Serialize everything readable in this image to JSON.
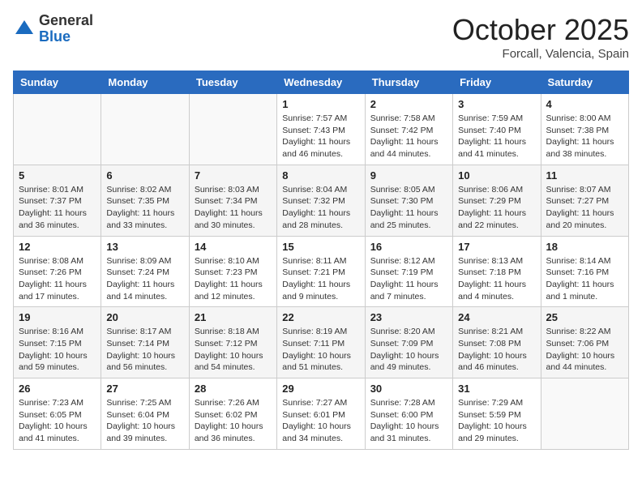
{
  "header": {
    "logo_general": "General",
    "logo_blue": "Blue",
    "month_title": "October 2025",
    "location": "Forcall, Valencia, Spain"
  },
  "weekdays": [
    "Sunday",
    "Monday",
    "Tuesday",
    "Wednesday",
    "Thursday",
    "Friday",
    "Saturday"
  ],
  "weeks": [
    [
      {
        "day": "",
        "info": ""
      },
      {
        "day": "",
        "info": ""
      },
      {
        "day": "",
        "info": ""
      },
      {
        "day": "1",
        "info": "Sunrise: 7:57 AM\nSunset: 7:43 PM\nDaylight: 11 hours and 46 minutes."
      },
      {
        "day": "2",
        "info": "Sunrise: 7:58 AM\nSunset: 7:42 PM\nDaylight: 11 hours and 44 minutes."
      },
      {
        "day": "3",
        "info": "Sunrise: 7:59 AM\nSunset: 7:40 PM\nDaylight: 11 hours and 41 minutes."
      },
      {
        "day": "4",
        "info": "Sunrise: 8:00 AM\nSunset: 7:38 PM\nDaylight: 11 hours and 38 minutes."
      }
    ],
    [
      {
        "day": "5",
        "info": "Sunrise: 8:01 AM\nSunset: 7:37 PM\nDaylight: 11 hours and 36 minutes."
      },
      {
        "day": "6",
        "info": "Sunrise: 8:02 AM\nSunset: 7:35 PM\nDaylight: 11 hours and 33 minutes."
      },
      {
        "day": "7",
        "info": "Sunrise: 8:03 AM\nSunset: 7:34 PM\nDaylight: 11 hours and 30 minutes."
      },
      {
        "day": "8",
        "info": "Sunrise: 8:04 AM\nSunset: 7:32 PM\nDaylight: 11 hours and 28 minutes."
      },
      {
        "day": "9",
        "info": "Sunrise: 8:05 AM\nSunset: 7:30 PM\nDaylight: 11 hours and 25 minutes."
      },
      {
        "day": "10",
        "info": "Sunrise: 8:06 AM\nSunset: 7:29 PM\nDaylight: 11 hours and 22 minutes."
      },
      {
        "day": "11",
        "info": "Sunrise: 8:07 AM\nSunset: 7:27 PM\nDaylight: 11 hours and 20 minutes."
      }
    ],
    [
      {
        "day": "12",
        "info": "Sunrise: 8:08 AM\nSunset: 7:26 PM\nDaylight: 11 hours and 17 minutes."
      },
      {
        "day": "13",
        "info": "Sunrise: 8:09 AM\nSunset: 7:24 PM\nDaylight: 11 hours and 14 minutes."
      },
      {
        "day": "14",
        "info": "Sunrise: 8:10 AM\nSunset: 7:23 PM\nDaylight: 11 hours and 12 minutes."
      },
      {
        "day": "15",
        "info": "Sunrise: 8:11 AM\nSunset: 7:21 PM\nDaylight: 11 hours and 9 minutes."
      },
      {
        "day": "16",
        "info": "Sunrise: 8:12 AM\nSunset: 7:19 PM\nDaylight: 11 hours and 7 minutes."
      },
      {
        "day": "17",
        "info": "Sunrise: 8:13 AM\nSunset: 7:18 PM\nDaylight: 11 hours and 4 minutes."
      },
      {
        "day": "18",
        "info": "Sunrise: 8:14 AM\nSunset: 7:16 PM\nDaylight: 11 hours and 1 minute."
      }
    ],
    [
      {
        "day": "19",
        "info": "Sunrise: 8:16 AM\nSunset: 7:15 PM\nDaylight: 10 hours and 59 minutes."
      },
      {
        "day": "20",
        "info": "Sunrise: 8:17 AM\nSunset: 7:14 PM\nDaylight: 10 hours and 56 minutes."
      },
      {
        "day": "21",
        "info": "Sunrise: 8:18 AM\nSunset: 7:12 PM\nDaylight: 10 hours and 54 minutes."
      },
      {
        "day": "22",
        "info": "Sunrise: 8:19 AM\nSunset: 7:11 PM\nDaylight: 10 hours and 51 minutes."
      },
      {
        "day": "23",
        "info": "Sunrise: 8:20 AM\nSunset: 7:09 PM\nDaylight: 10 hours and 49 minutes."
      },
      {
        "day": "24",
        "info": "Sunrise: 8:21 AM\nSunset: 7:08 PM\nDaylight: 10 hours and 46 minutes."
      },
      {
        "day": "25",
        "info": "Sunrise: 8:22 AM\nSunset: 7:06 PM\nDaylight: 10 hours and 44 minutes."
      }
    ],
    [
      {
        "day": "26",
        "info": "Sunrise: 7:23 AM\nSunset: 6:05 PM\nDaylight: 10 hours and 41 minutes."
      },
      {
        "day": "27",
        "info": "Sunrise: 7:25 AM\nSunset: 6:04 PM\nDaylight: 10 hours and 39 minutes."
      },
      {
        "day": "28",
        "info": "Sunrise: 7:26 AM\nSunset: 6:02 PM\nDaylight: 10 hours and 36 minutes."
      },
      {
        "day": "29",
        "info": "Sunrise: 7:27 AM\nSunset: 6:01 PM\nDaylight: 10 hours and 34 minutes."
      },
      {
        "day": "30",
        "info": "Sunrise: 7:28 AM\nSunset: 6:00 PM\nDaylight: 10 hours and 31 minutes."
      },
      {
        "day": "31",
        "info": "Sunrise: 7:29 AM\nSunset: 5:59 PM\nDaylight: 10 hours and 29 minutes."
      },
      {
        "day": "",
        "info": ""
      }
    ]
  ]
}
